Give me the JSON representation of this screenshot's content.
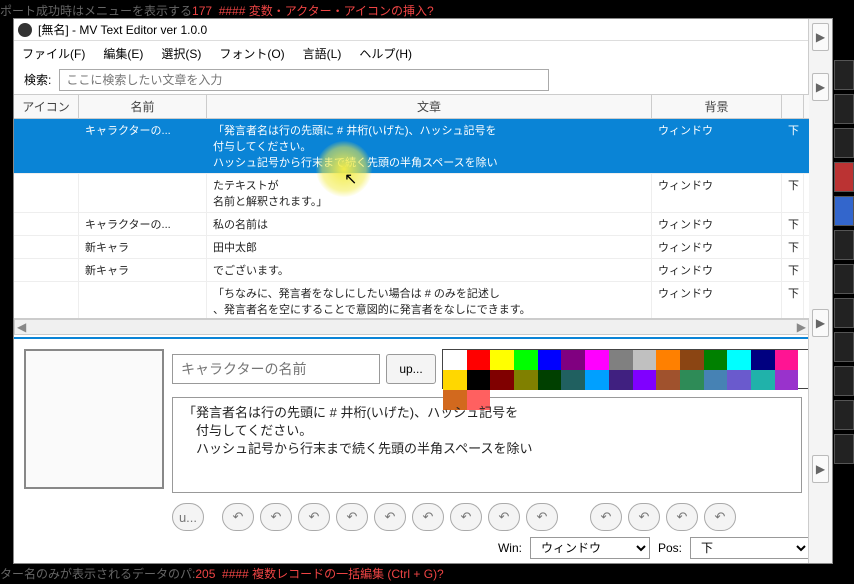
{
  "bg": {
    "top": "ポート成功時はメニューを表示する|177  #### 変数・アクター・アイコンの挿入?",
    "bottom": "ター名のみが表示されるデータのパ:|205  #### 複数レコードの一括編集 (Ctrl + G)?"
  },
  "title": "[無名] - MV Text Editor ver 1.0.0",
  "menu": {
    "file": "ファイル(F)",
    "edit": "編集(E)",
    "select": "選択(S)",
    "font": "フォント(O)",
    "lang": "言語(L)",
    "help": "ヘルプ(H)"
  },
  "search": {
    "label": "検索:",
    "placeholder": "ここに検索したい文章を入力"
  },
  "columns": {
    "icon": "アイコン",
    "name": "名前",
    "text": "文章",
    "bg": "背景",
    "pos": ""
  },
  "rows": [
    {
      "name": "キャラクターの...",
      "text": "「発言者名は行の先頭に # 井桁(いげた)、ハッシュ記号を\n付与してください。\nハッシュ記号から行末まで続く先頭の半角スペースを除い",
      "bg": "ウィンドウ",
      "pos": "下"
    },
    {
      "name": "",
      "text": "たテキストが\n名前と解釈されます。」",
      "bg": "ウィンドウ",
      "pos": "下"
    },
    {
      "name": "キャラクターの...",
      "text": "私の名前は",
      "bg": "ウィンドウ",
      "pos": "下"
    },
    {
      "name": "新キャラ",
      "text": "田中太郎",
      "bg": "ウィンドウ",
      "pos": "下"
    },
    {
      "name": "新キャラ",
      "text": "でございます。",
      "bg": "ウィンドウ",
      "pos": "下"
    },
    {
      "name": "",
      "text": "「ちなみに、発言者をなしにしたい場合は # のみを記述し\n、発言者名を空にすることで意図的に発言者をなしにできます。",
      "bg": "ウィンドウ",
      "pos": "下"
    }
  ],
  "editor": {
    "namePlaceholder": "キャラクターの名前",
    "upBtn": "up...",
    "text": "「発言者名は行の先頭に # 井桁(いげた)、ハッシュ記号を\n　付与してください。\n　ハッシュ記号から行末まで続く先頭の半角スペースを除い",
    "uBtn": "u..."
  },
  "winpos": {
    "winLabel": "Win:",
    "winValue": "ウィンドウ",
    "posLabel": "Pos:",
    "posValue": "下"
  },
  "palette": [
    "#ffffff",
    "#ff0000",
    "#ffff00",
    "#00ff00",
    "#0000ff",
    "#800080",
    "#ff00ff",
    "#808080",
    "#c0c0c0",
    "#ff8000",
    "#8b4513",
    "#008000",
    "#00ffff",
    "#000080",
    "#ff1493",
    "#ffd700",
    "#000000",
    "#800000",
    "#808000",
    "#004000",
    "#206060",
    "#00a0ff",
    "#402080",
    "#8000ff",
    "#a0522d",
    "#2e8b57",
    "#4682b4",
    "#6a5acd",
    "#20b2aa",
    "#9932cc",
    "#d2691e",
    "#ff6060"
  ]
}
